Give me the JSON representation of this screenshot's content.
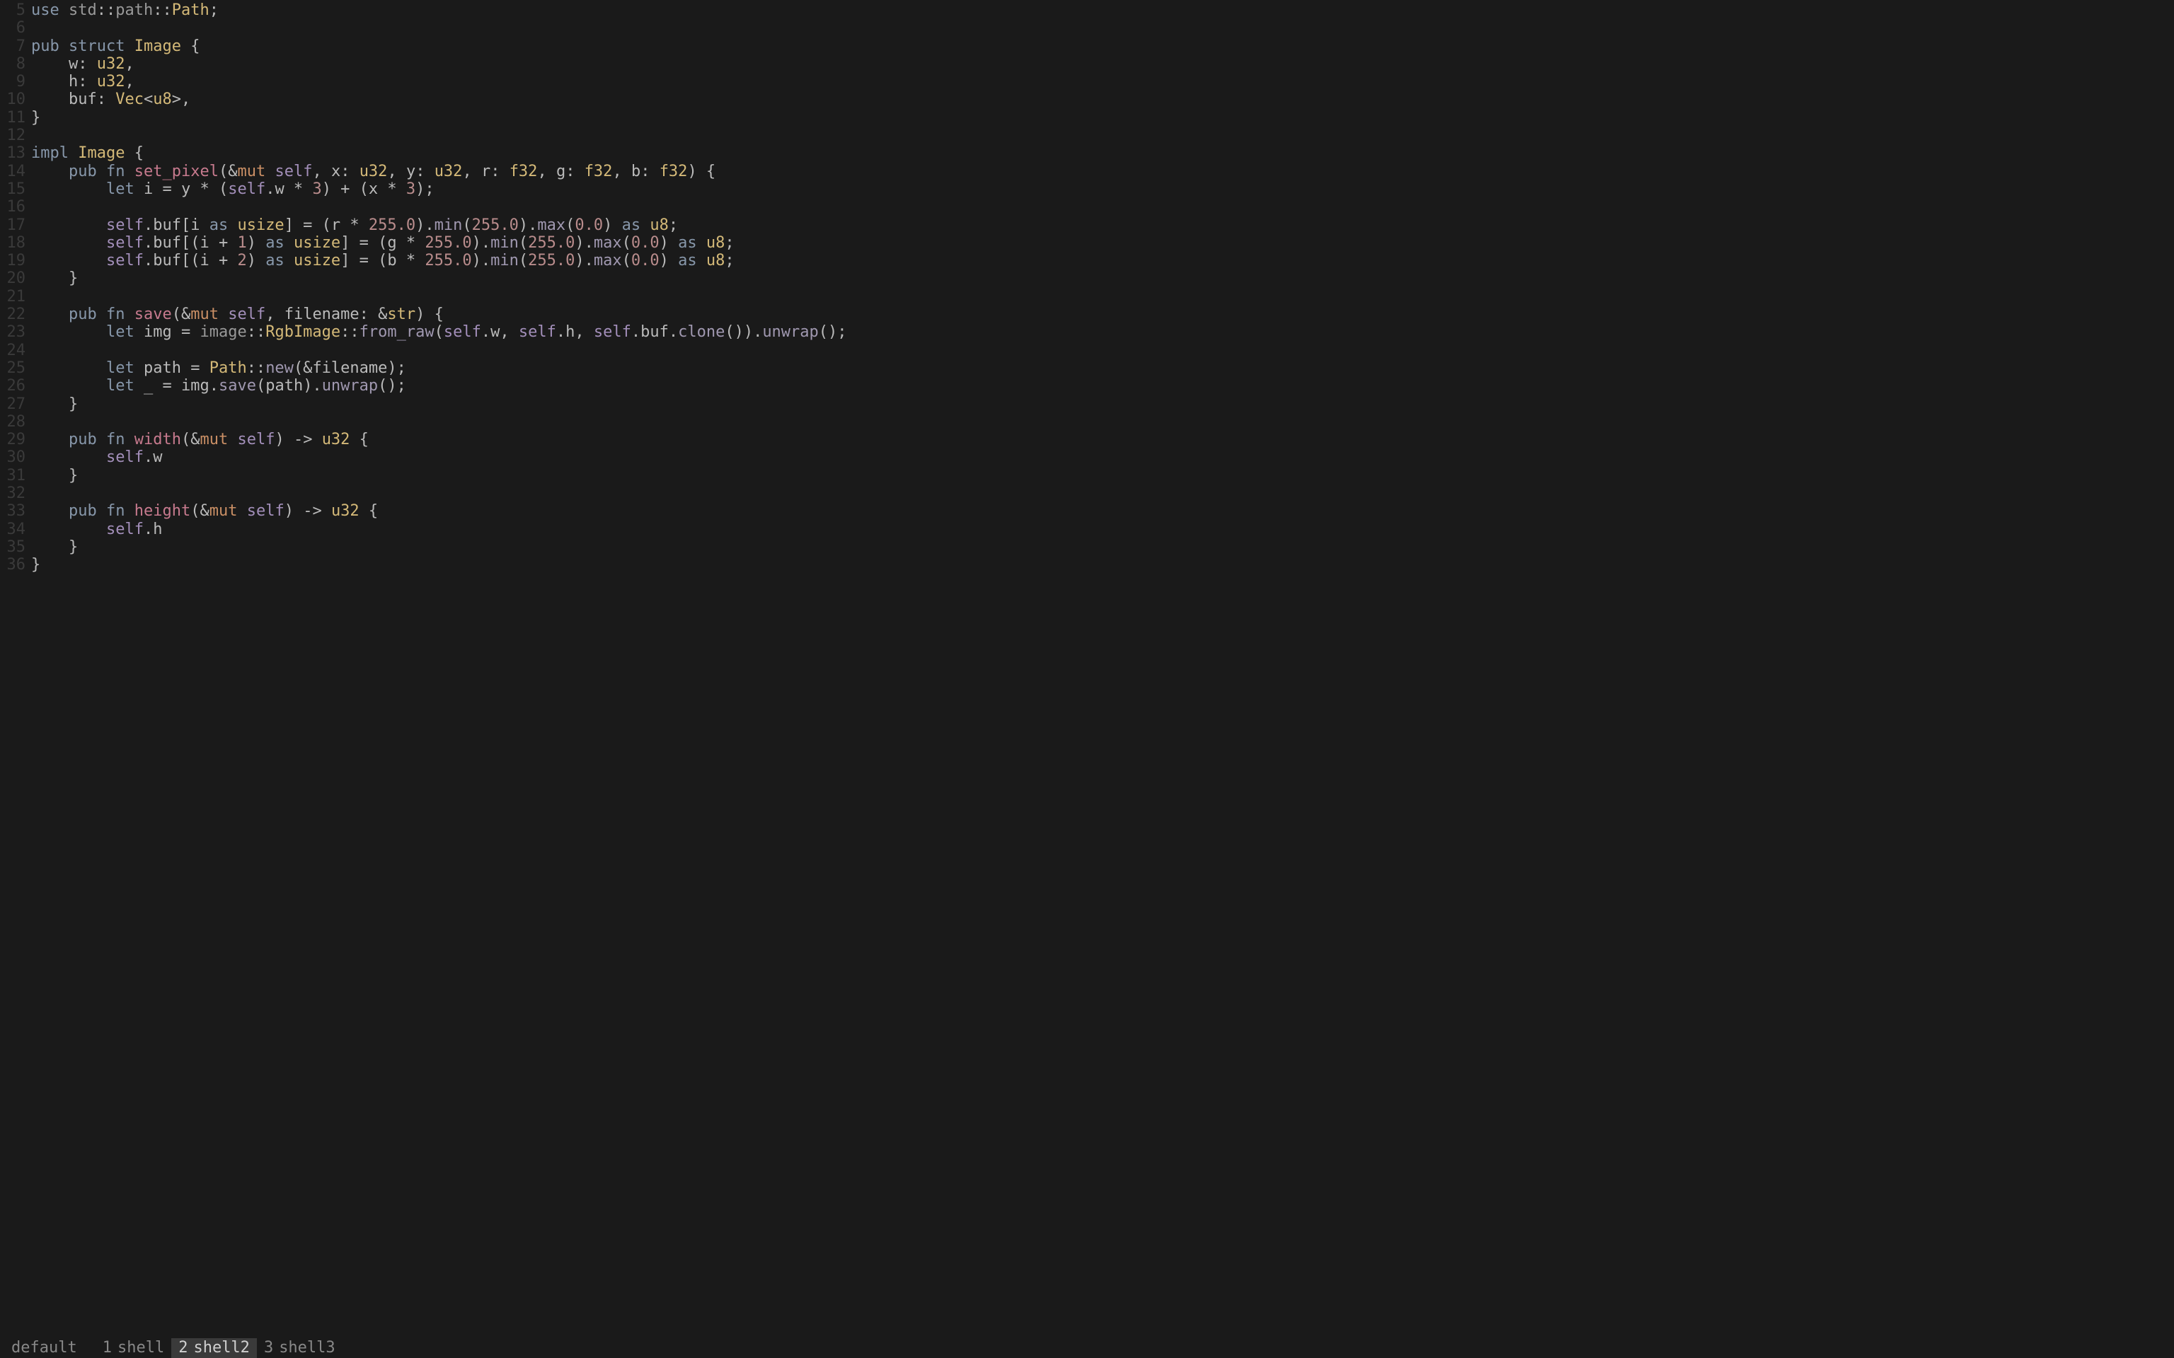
{
  "gutter": {
    "start": 5,
    "end": 36
  },
  "code_lines": [
    [
      {
        "c": "kw",
        "t": "use"
      },
      {
        "c": "punct",
        "t": " "
      },
      {
        "c": "mod",
        "t": "std"
      },
      {
        "c": "punct",
        "t": "::"
      },
      {
        "c": "mod",
        "t": "path"
      },
      {
        "c": "punct",
        "t": "::"
      },
      {
        "c": "ty",
        "t": "Path"
      },
      {
        "c": "punct",
        "t": ";"
      }
    ],
    [],
    [
      {
        "c": "kw",
        "t": "pub"
      },
      {
        "c": "punct",
        "t": " "
      },
      {
        "c": "kw",
        "t": "struct"
      },
      {
        "c": "punct",
        "t": " "
      },
      {
        "c": "ty",
        "t": "Image"
      },
      {
        "c": "punct",
        "t": " {"
      }
    ],
    [
      {
        "c": "punct",
        "t": "    "
      },
      {
        "c": "field",
        "t": "w"
      },
      {
        "c": "punct",
        "t": ": "
      },
      {
        "c": "ty",
        "t": "u32"
      },
      {
        "c": "punct",
        "t": ","
      }
    ],
    [
      {
        "c": "punct",
        "t": "    "
      },
      {
        "c": "field",
        "t": "h"
      },
      {
        "c": "punct",
        "t": ": "
      },
      {
        "c": "ty",
        "t": "u32"
      },
      {
        "c": "punct",
        "t": ","
      }
    ],
    [
      {
        "c": "punct",
        "t": "    "
      },
      {
        "c": "field",
        "t": "buf"
      },
      {
        "c": "punct",
        "t": ": "
      },
      {
        "c": "ty",
        "t": "Vec"
      },
      {
        "c": "punct",
        "t": "<"
      },
      {
        "c": "ty",
        "t": "u8"
      },
      {
        "c": "punct",
        "t": ">,"
      }
    ],
    [
      {
        "c": "punct",
        "t": "}"
      }
    ],
    [],
    [
      {
        "c": "kw",
        "t": "impl"
      },
      {
        "c": "punct",
        "t": " "
      },
      {
        "c": "ty",
        "t": "Image"
      },
      {
        "c": "punct",
        "t": " {"
      }
    ],
    [
      {
        "c": "punct",
        "t": "    "
      },
      {
        "c": "kw",
        "t": "pub"
      },
      {
        "c": "punct",
        "t": " "
      },
      {
        "c": "kw",
        "t": "fn"
      },
      {
        "c": "punct",
        "t": " "
      },
      {
        "c": "fn",
        "t": "set_pixel"
      },
      {
        "c": "punct",
        "t": "(&"
      },
      {
        "c": "mut",
        "t": "mut"
      },
      {
        "c": "punct",
        "t": " "
      },
      {
        "c": "self",
        "t": "self"
      },
      {
        "c": "punct",
        "t": ", "
      },
      {
        "c": "var",
        "t": "x"
      },
      {
        "c": "punct",
        "t": ": "
      },
      {
        "c": "ty",
        "t": "u32"
      },
      {
        "c": "punct",
        "t": ", "
      },
      {
        "c": "var",
        "t": "y"
      },
      {
        "c": "punct",
        "t": ": "
      },
      {
        "c": "ty",
        "t": "u32"
      },
      {
        "c": "punct",
        "t": ", "
      },
      {
        "c": "var",
        "t": "r"
      },
      {
        "c": "punct",
        "t": ": "
      },
      {
        "c": "ty",
        "t": "f32"
      },
      {
        "c": "punct",
        "t": ", "
      },
      {
        "c": "var",
        "t": "g"
      },
      {
        "c": "punct",
        "t": ": "
      },
      {
        "c": "ty",
        "t": "f32"
      },
      {
        "c": "punct",
        "t": ", "
      },
      {
        "c": "var",
        "t": "b"
      },
      {
        "c": "punct",
        "t": ": "
      },
      {
        "c": "ty",
        "t": "f32"
      },
      {
        "c": "punct",
        "t": ") {"
      }
    ],
    [
      {
        "c": "punct",
        "t": "        "
      },
      {
        "c": "kw",
        "t": "let"
      },
      {
        "c": "punct",
        "t": " "
      },
      {
        "c": "var",
        "t": "i"
      },
      {
        "c": "punct",
        "t": " = "
      },
      {
        "c": "var",
        "t": "y"
      },
      {
        "c": "punct",
        "t": " * ("
      },
      {
        "c": "self",
        "t": "self"
      },
      {
        "c": "punct",
        "t": "."
      },
      {
        "c": "field",
        "t": "w"
      },
      {
        "c": "punct",
        "t": " * "
      },
      {
        "c": "num",
        "t": "3"
      },
      {
        "c": "punct",
        "t": ") + ("
      },
      {
        "c": "var",
        "t": "x"
      },
      {
        "c": "punct",
        "t": " * "
      },
      {
        "c": "num",
        "t": "3"
      },
      {
        "c": "punct",
        "t": ");"
      }
    ],
    [],
    [
      {
        "c": "punct",
        "t": "        "
      },
      {
        "c": "self",
        "t": "self"
      },
      {
        "c": "punct",
        "t": "."
      },
      {
        "c": "field",
        "t": "buf"
      },
      {
        "c": "punct",
        "t": "["
      },
      {
        "c": "var",
        "t": "i"
      },
      {
        "c": "punct",
        "t": " "
      },
      {
        "c": "kw",
        "t": "as"
      },
      {
        "c": "punct",
        "t": " "
      },
      {
        "c": "ty",
        "t": "usize"
      },
      {
        "c": "punct",
        "t": "] = ("
      },
      {
        "c": "var",
        "t": "r"
      },
      {
        "c": "punct",
        "t": " * "
      },
      {
        "c": "num",
        "t": "255.0"
      },
      {
        "c": "punct",
        "t": ")."
      },
      {
        "c": "meth",
        "t": "min"
      },
      {
        "c": "punct",
        "t": "("
      },
      {
        "c": "num",
        "t": "255.0"
      },
      {
        "c": "punct",
        "t": ")."
      },
      {
        "c": "meth",
        "t": "max"
      },
      {
        "c": "punct",
        "t": "("
      },
      {
        "c": "num",
        "t": "0.0"
      },
      {
        "c": "punct",
        "t": ") "
      },
      {
        "c": "kw",
        "t": "as"
      },
      {
        "c": "punct",
        "t": " "
      },
      {
        "c": "ty",
        "t": "u8"
      },
      {
        "c": "punct",
        "t": ";"
      }
    ],
    [
      {
        "c": "punct",
        "t": "        "
      },
      {
        "c": "self",
        "t": "self"
      },
      {
        "c": "punct",
        "t": "."
      },
      {
        "c": "field",
        "t": "buf"
      },
      {
        "c": "punct",
        "t": "[("
      },
      {
        "c": "var",
        "t": "i"
      },
      {
        "c": "punct",
        "t": " + "
      },
      {
        "c": "num",
        "t": "1"
      },
      {
        "c": "punct",
        "t": ") "
      },
      {
        "c": "kw",
        "t": "as"
      },
      {
        "c": "punct",
        "t": " "
      },
      {
        "c": "ty",
        "t": "usize"
      },
      {
        "c": "punct",
        "t": "] = ("
      },
      {
        "c": "var",
        "t": "g"
      },
      {
        "c": "punct",
        "t": " * "
      },
      {
        "c": "num",
        "t": "255.0"
      },
      {
        "c": "punct",
        "t": ")."
      },
      {
        "c": "meth",
        "t": "min"
      },
      {
        "c": "punct",
        "t": "("
      },
      {
        "c": "num",
        "t": "255.0"
      },
      {
        "c": "punct",
        "t": ")."
      },
      {
        "c": "meth",
        "t": "max"
      },
      {
        "c": "punct",
        "t": "("
      },
      {
        "c": "num",
        "t": "0.0"
      },
      {
        "c": "punct",
        "t": ") "
      },
      {
        "c": "kw",
        "t": "as"
      },
      {
        "c": "punct",
        "t": " "
      },
      {
        "c": "ty",
        "t": "u8"
      },
      {
        "c": "punct",
        "t": ";"
      }
    ],
    [
      {
        "c": "punct",
        "t": "        "
      },
      {
        "c": "self",
        "t": "self"
      },
      {
        "c": "punct",
        "t": "."
      },
      {
        "c": "field",
        "t": "buf"
      },
      {
        "c": "punct",
        "t": "[("
      },
      {
        "c": "var",
        "t": "i"
      },
      {
        "c": "punct",
        "t": " + "
      },
      {
        "c": "num",
        "t": "2"
      },
      {
        "c": "punct",
        "t": ") "
      },
      {
        "c": "kw",
        "t": "as"
      },
      {
        "c": "punct",
        "t": " "
      },
      {
        "c": "ty",
        "t": "usize"
      },
      {
        "c": "punct",
        "t": "] = ("
      },
      {
        "c": "var",
        "t": "b"
      },
      {
        "c": "punct",
        "t": " * "
      },
      {
        "c": "num",
        "t": "255.0"
      },
      {
        "c": "punct",
        "t": ")."
      },
      {
        "c": "meth",
        "t": "min"
      },
      {
        "c": "punct",
        "t": "("
      },
      {
        "c": "num",
        "t": "255.0"
      },
      {
        "c": "punct",
        "t": ")."
      },
      {
        "c": "meth",
        "t": "max"
      },
      {
        "c": "punct",
        "t": "("
      },
      {
        "c": "num",
        "t": "0.0"
      },
      {
        "c": "punct",
        "t": ") "
      },
      {
        "c": "kw",
        "t": "as"
      },
      {
        "c": "punct",
        "t": " "
      },
      {
        "c": "ty",
        "t": "u8"
      },
      {
        "c": "punct",
        "t": ";"
      }
    ],
    [
      {
        "c": "punct",
        "t": "    }"
      }
    ],
    [],
    [
      {
        "c": "punct",
        "t": "    "
      },
      {
        "c": "kw",
        "t": "pub"
      },
      {
        "c": "punct",
        "t": " "
      },
      {
        "c": "kw",
        "t": "fn"
      },
      {
        "c": "punct",
        "t": " "
      },
      {
        "c": "fn",
        "t": "save"
      },
      {
        "c": "punct",
        "t": "(&"
      },
      {
        "c": "mut",
        "t": "mut"
      },
      {
        "c": "punct",
        "t": " "
      },
      {
        "c": "self",
        "t": "self"
      },
      {
        "c": "punct",
        "t": ", "
      },
      {
        "c": "var",
        "t": "filename"
      },
      {
        "c": "punct",
        "t": ": &"
      },
      {
        "c": "ty",
        "t": "str"
      },
      {
        "c": "punct",
        "t": ") {"
      }
    ],
    [
      {
        "c": "punct",
        "t": "        "
      },
      {
        "c": "kw",
        "t": "let"
      },
      {
        "c": "punct",
        "t": " "
      },
      {
        "c": "var",
        "t": "img"
      },
      {
        "c": "punct",
        "t": " = "
      },
      {
        "c": "mod",
        "t": "image"
      },
      {
        "c": "punct",
        "t": "::"
      },
      {
        "c": "ty",
        "t": "RgbImage"
      },
      {
        "c": "punct",
        "t": "::"
      },
      {
        "c": "meth",
        "t": "from_raw"
      },
      {
        "c": "punct",
        "t": "("
      },
      {
        "c": "self",
        "t": "self"
      },
      {
        "c": "punct",
        "t": "."
      },
      {
        "c": "field",
        "t": "w"
      },
      {
        "c": "punct",
        "t": ", "
      },
      {
        "c": "self",
        "t": "self"
      },
      {
        "c": "punct",
        "t": "."
      },
      {
        "c": "field",
        "t": "h"
      },
      {
        "c": "punct",
        "t": ", "
      },
      {
        "c": "self",
        "t": "self"
      },
      {
        "c": "punct",
        "t": "."
      },
      {
        "c": "field",
        "t": "buf"
      },
      {
        "c": "punct",
        "t": "."
      },
      {
        "c": "meth",
        "t": "clone"
      },
      {
        "c": "punct",
        "t": "())."
      },
      {
        "c": "meth",
        "t": "unwrap"
      },
      {
        "c": "punct",
        "t": "();"
      }
    ],
    [],
    [
      {
        "c": "punct",
        "t": "        "
      },
      {
        "c": "kw",
        "t": "let"
      },
      {
        "c": "punct",
        "t": " "
      },
      {
        "c": "var",
        "t": "path"
      },
      {
        "c": "punct",
        "t": " = "
      },
      {
        "c": "ty",
        "t": "Path"
      },
      {
        "c": "punct",
        "t": "::"
      },
      {
        "c": "meth",
        "t": "new"
      },
      {
        "c": "punct",
        "t": "(&"
      },
      {
        "c": "var",
        "t": "filename"
      },
      {
        "c": "punct",
        "t": ");"
      }
    ],
    [
      {
        "c": "punct",
        "t": "        "
      },
      {
        "c": "kw",
        "t": "let"
      },
      {
        "c": "punct",
        "t": " "
      },
      {
        "c": "var",
        "t": "_"
      },
      {
        "c": "punct",
        "t": " = "
      },
      {
        "c": "var",
        "t": "img"
      },
      {
        "c": "punct",
        "t": "."
      },
      {
        "c": "meth",
        "t": "save"
      },
      {
        "c": "punct",
        "t": "("
      },
      {
        "c": "var",
        "t": "path"
      },
      {
        "c": "punct",
        "t": ")."
      },
      {
        "c": "meth",
        "t": "unwrap"
      },
      {
        "c": "punct",
        "t": "();"
      }
    ],
    [
      {
        "c": "punct",
        "t": "    }"
      }
    ],
    [],
    [
      {
        "c": "punct",
        "t": "    "
      },
      {
        "c": "kw",
        "t": "pub"
      },
      {
        "c": "punct",
        "t": " "
      },
      {
        "c": "kw",
        "t": "fn"
      },
      {
        "c": "punct",
        "t": " "
      },
      {
        "c": "fn",
        "t": "width"
      },
      {
        "c": "punct",
        "t": "(&"
      },
      {
        "c": "mut",
        "t": "mut"
      },
      {
        "c": "punct",
        "t": " "
      },
      {
        "c": "self",
        "t": "self"
      },
      {
        "c": "punct",
        "t": ") -> "
      },
      {
        "c": "ty",
        "t": "u32"
      },
      {
        "c": "punct",
        "t": " {"
      }
    ],
    [
      {
        "c": "punct",
        "t": "        "
      },
      {
        "c": "self",
        "t": "self"
      },
      {
        "c": "punct",
        "t": "."
      },
      {
        "c": "field",
        "t": "w"
      }
    ],
    [
      {
        "c": "punct",
        "t": "    }"
      }
    ],
    [],
    [
      {
        "c": "punct",
        "t": "    "
      },
      {
        "c": "kw",
        "t": "pub"
      },
      {
        "c": "punct",
        "t": " "
      },
      {
        "c": "kw",
        "t": "fn"
      },
      {
        "c": "punct",
        "t": " "
      },
      {
        "c": "fn",
        "t": "height"
      },
      {
        "c": "punct",
        "t": "(&"
      },
      {
        "c": "mut",
        "t": "mut"
      },
      {
        "c": "punct",
        "t": " "
      },
      {
        "c": "self",
        "t": "self"
      },
      {
        "c": "punct",
        "t": ") -> "
      },
      {
        "c": "ty",
        "t": "u32"
      },
      {
        "c": "punct",
        "t": " {"
      }
    ],
    [
      {
        "c": "punct",
        "t": "        "
      },
      {
        "c": "self",
        "t": "self"
      },
      {
        "c": "punct",
        "t": "."
      },
      {
        "c": "field",
        "t": "h"
      }
    ],
    [
      {
        "c": "punct",
        "t": "    }"
      }
    ],
    [
      {
        "c": "punct",
        "t": "}"
      }
    ]
  ],
  "statusbar": {
    "session": "default",
    "tabs": [
      {
        "index": "1",
        "name": "shell",
        "active": false
      },
      {
        "index": "2",
        "name": "shell2",
        "active": true
      },
      {
        "index": "3",
        "name": "shell3",
        "active": false
      }
    ]
  }
}
